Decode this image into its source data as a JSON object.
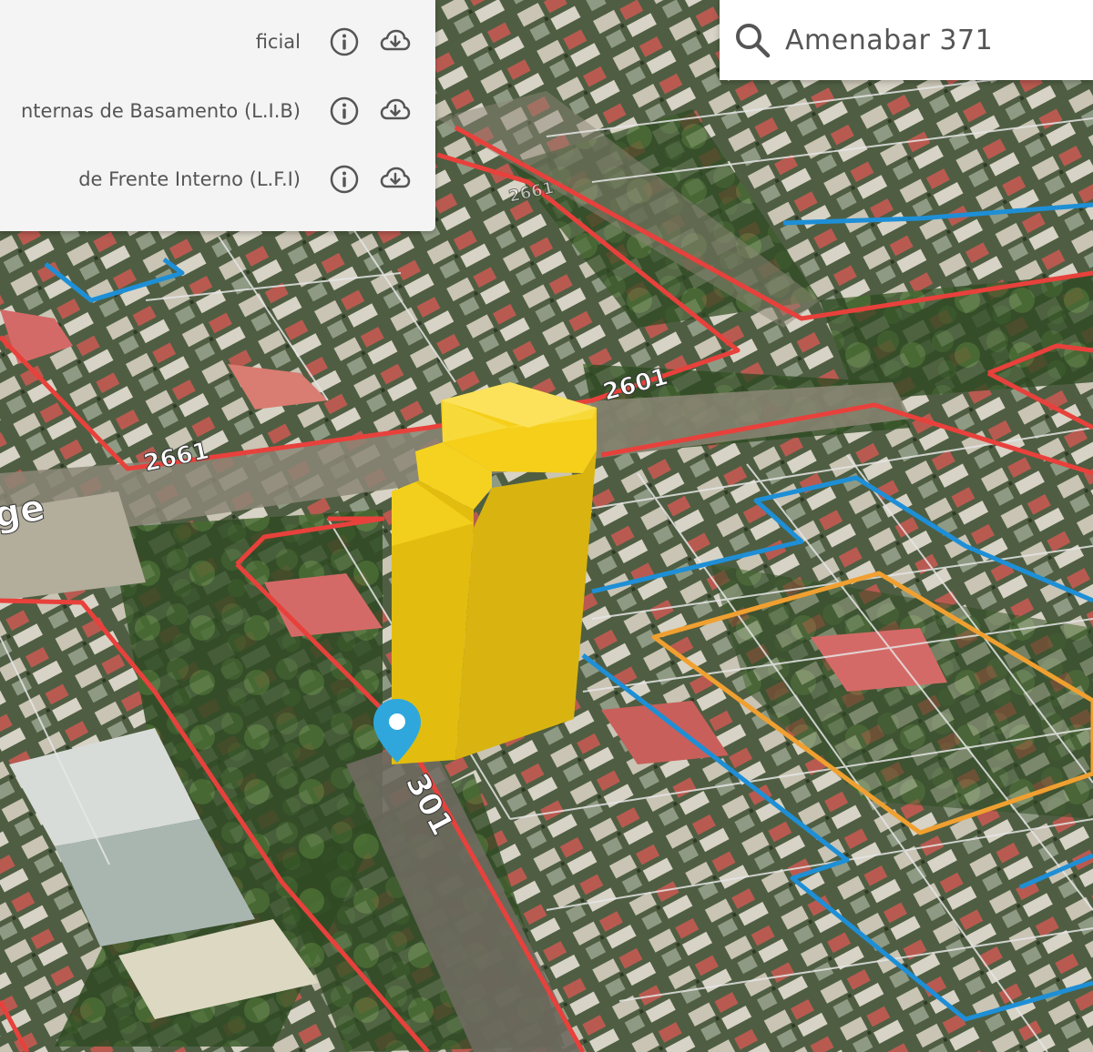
{
  "layers_panel": {
    "items": [
      {
        "label": "ficial",
        "info_icon": "info-circle-icon",
        "download_icon": "cloud-download-icon"
      },
      {
        "label": "nternas de Basamento (L.I.B)",
        "info_icon": "info-circle-icon",
        "download_icon": "cloud-download-icon"
      },
      {
        "label": "de Frente Interno (L.F.I)",
        "info_icon": "info-circle-icon",
        "download_icon": "cloud-download-icon"
      }
    ]
  },
  "search": {
    "value": "Amenabar 371",
    "icon": "search-icon"
  },
  "map": {
    "street_labels": [
      "2661",
      "2601",
      "2661",
      "301",
      "ge"
    ],
    "marker_icon": "map-pin-icon",
    "colors": {
      "block_outline": "#e8413c",
      "lfi_line": "#1e8fd6",
      "lib_line": "#f0a030",
      "building_top": "#f5cf1a",
      "building_side": "#d9b411",
      "marker": "#2fa7dc",
      "panel_icon": "#555555"
    }
  }
}
